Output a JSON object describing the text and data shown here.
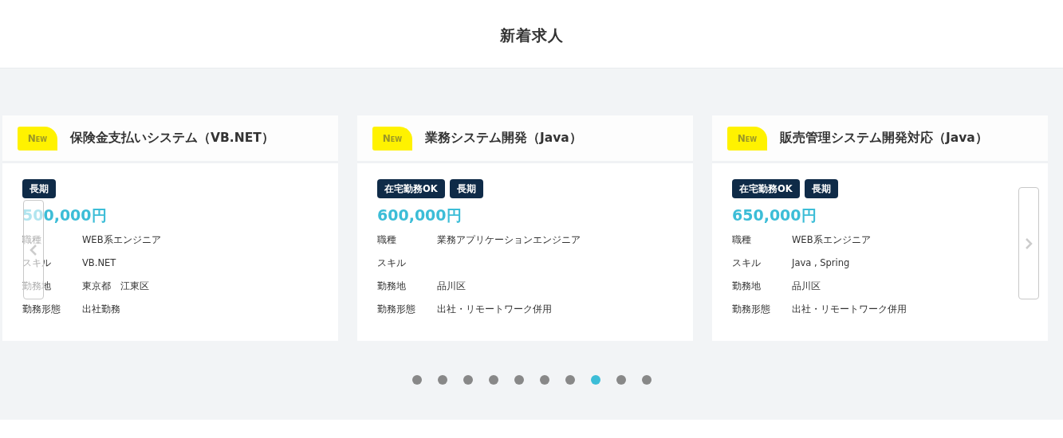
{
  "section_title": "新着求人",
  "jobs": [
    {
      "badge": "New",
      "title": "保険金支払いシステム（VB.NET）",
      "tags": [
        "長期"
      ],
      "salary": "500,000円",
      "details": [
        {
          "label": "職種",
          "value": "WEB系エンジニア"
        },
        {
          "label": "スキル",
          "value": "VB.NET"
        },
        {
          "label": "勤務地",
          "value": "東京都　江東区"
        },
        {
          "label": "勤務形態",
          "value": "出社勤務"
        }
      ]
    },
    {
      "badge": "New",
      "title": "業務システム開発（Java）",
      "tags": [
        "在宅勤務OK",
        "長期"
      ],
      "salary": "600,000円",
      "details": [
        {
          "label": "職種",
          "value": "業務アプリケーションエンジニア"
        },
        {
          "label": "スキル"
        },
        {
          "label": "勤務地",
          "value": "品川区"
        },
        {
          "label": "勤務形態",
          "value": "出社・リモートワーク併用"
        }
      ]
    },
    {
      "badge": "New",
      "title": "販売管理システム開発対応（Java）",
      "tags": [
        "在宅勤務OK",
        "長期"
      ],
      "salary": "650,000円",
      "details": [
        {
          "label": "職種",
          "value": "WEB系エンジニア"
        },
        {
          "label": "スキル",
          "value": "Java , Spring"
        },
        {
          "label": "勤務地",
          "value": "品川区"
        },
        {
          "label": "勤務形態",
          "value": "出社・リモートワーク併用"
        }
      ]
    }
  ],
  "dots": [
    {
      "selected": false
    },
    {
      "selected": false
    },
    {
      "selected": false
    },
    {
      "selected": false
    },
    {
      "selected": false
    },
    {
      "selected": false
    },
    {
      "selected": false
    },
    {
      "selected": true
    },
    {
      "selected": false
    },
    {
      "selected": false
    }
  ]
}
